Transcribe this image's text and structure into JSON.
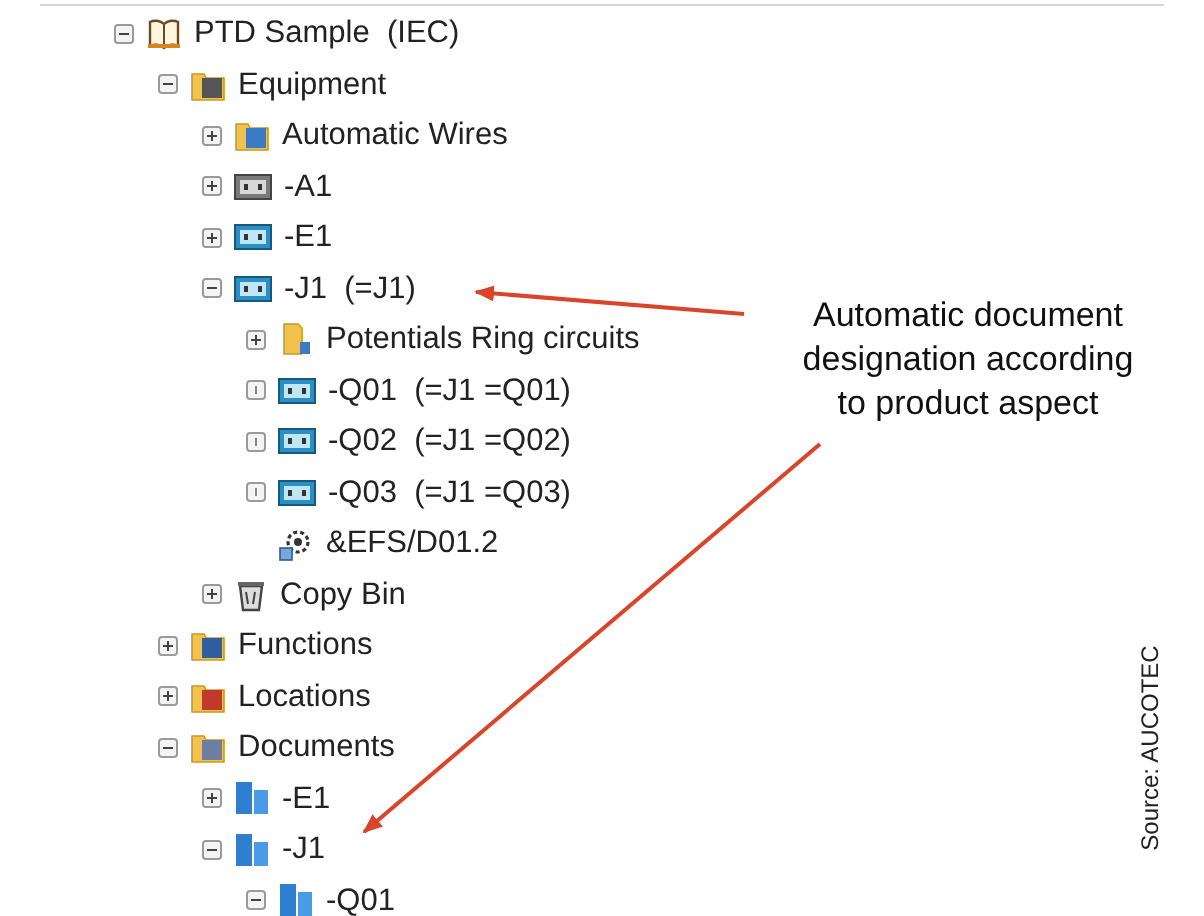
{
  "tree": [
    {
      "label": "PTD Sample  (IEC)",
      "kind": "book",
      "expanded": true,
      "children": [
        {
          "label": "Equipment",
          "kind": "equipment",
          "expanded": true,
          "children": [
            {
              "label": "Automatic Wires",
              "kind": "wires",
              "expanded": false
            },
            {
              "label": "-A1",
              "kind": "cabinet",
              "expanded": false
            },
            {
              "label": "-E1",
              "kind": "device",
              "expanded": false
            },
            {
              "label": "-J1  (=J1)",
              "kind": "device",
              "expanded": true,
              "children": [
                {
                  "label": "Potentials Ring circuits",
                  "kind": "folder",
                  "expanded": false
                },
                {
                  "label": "-Q01  (=J1 =Q01)",
                  "kind": "device",
                  "expanded": false,
                  "empty": true
                },
                {
                  "label": "-Q02  (=J1 =Q02)",
                  "kind": "device",
                  "expanded": false,
                  "empty": true
                },
                {
                  "label": "-Q03  (=J1 =Q03)",
                  "kind": "device",
                  "expanded": false,
                  "empty": true
                },
                {
                  "label": "&EFS/D01.2",
                  "kind": "symbol"
                }
              ]
            },
            {
              "label": "Copy Bin",
              "kind": "bin",
              "expanded": false
            }
          ]
        },
        {
          "label": "Functions",
          "kind": "functions",
          "expanded": false
        },
        {
          "label": "Locations",
          "kind": "locations",
          "expanded": false
        },
        {
          "label": "Documents",
          "kind": "documents",
          "expanded": true,
          "children": [
            {
              "label": "-E1",
              "kind": "document",
              "expanded": false
            },
            {
              "label": "-J1",
              "kind": "document",
              "expanded": true,
              "children": [
                {
                  "label": "-Q01",
                  "kind": "document",
                  "expanded": true
                }
              ]
            }
          ]
        }
      ]
    }
  ],
  "callout": "Automatic document designation according to product aspect",
  "source_credit": "Source: AUCOTEC"
}
